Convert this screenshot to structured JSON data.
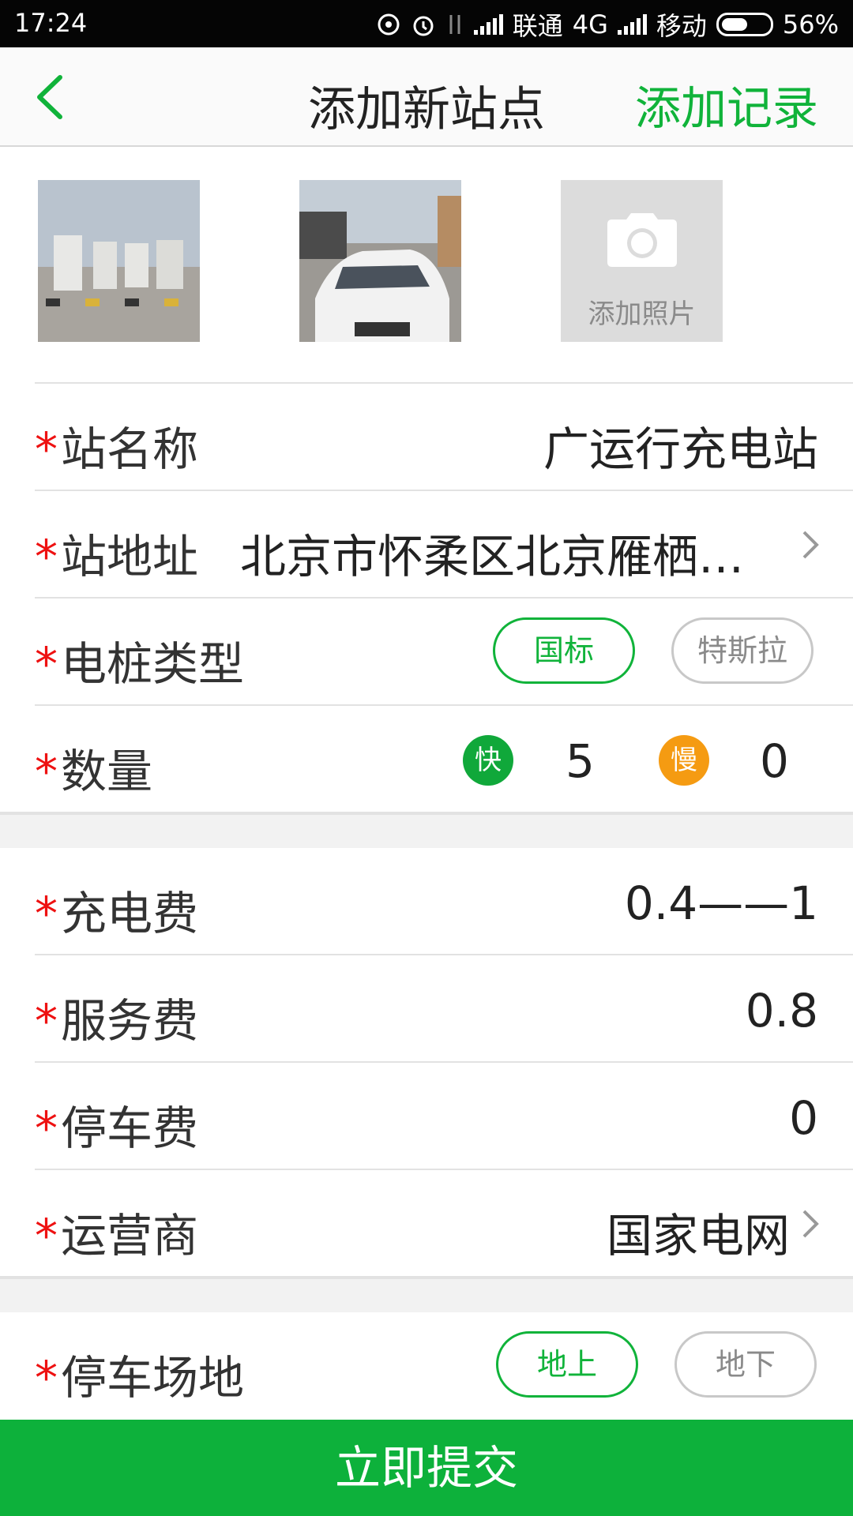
{
  "status": {
    "time": "17:24",
    "carrier1": "联通",
    "network": "4G",
    "carrier2": "移动",
    "battery": "56%",
    "battery_level": 0.56
  },
  "header": {
    "title": "添加新站点",
    "action": "添加记录"
  },
  "photos": {
    "add_label": "添加照片"
  },
  "form": {
    "required_mark": "*",
    "name": {
      "label": "站名称",
      "value": "广运行充电站"
    },
    "address": {
      "label": "站地址",
      "value": "北京市怀柔区北京雁栖经济开发区"
    },
    "pile_type": {
      "label": "电桩类型",
      "options": [
        "国标",
        "特斯拉"
      ],
      "selected": "国标"
    },
    "quantity": {
      "label": "数量",
      "fast_badge": "快",
      "fast_count": "5",
      "slow_badge": "慢",
      "slow_count": "0"
    },
    "charge_fee": {
      "label": "充电费",
      "value": "0.4——1"
    },
    "service_fee": {
      "label": "服务费",
      "value": "0.8"
    },
    "parking_fee": {
      "label": "停车费",
      "value": "0"
    },
    "operator": {
      "label": "运营商",
      "value": "国家电网"
    },
    "parking_place": {
      "label": "停车场地",
      "options": [
        "地上",
        "地下"
      ],
      "selected": "地上"
    }
  },
  "submit_label": "立即提交",
  "colors": {
    "accent": "#10b33a",
    "required": "#e11111",
    "slow": "#f59b12"
  }
}
